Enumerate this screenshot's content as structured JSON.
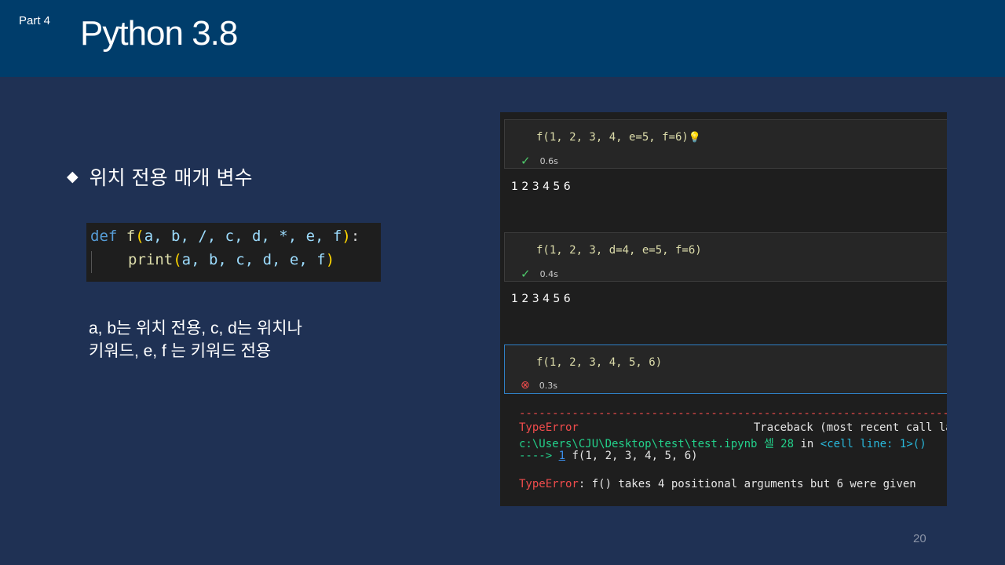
{
  "header": {
    "part": "Part 4",
    "title": "Python 3.8"
  },
  "bullet": {
    "symbol": "◆",
    "text": "위치 전용 매개 변수"
  },
  "code_snippet": {
    "line1": {
      "def": "def",
      "space": " ",
      "fname": "f",
      "open": "(",
      "params": "a, b, /, c, d, *, e, f",
      "close": ")",
      "colon": ":"
    },
    "line2": {
      "fname": "print",
      "open": "(",
      "args": "a, b, c, d, e, f",
      "close": ")"
    }
  },
  "description": {
    "line1": "a, b는 위치 전용, c, d는 위치나",
    "line2": "키워드, e, f 는 키워드 전용"
  },
  "notebook": {
    "cells": [
      {
        "code": "f(1, 2, 3, 4, e=5, f=6)",
        "time": "0.6s",
        "status": "success",
        "output": "1 2 3 4 5 6"
      },
      {
        "code": "f(1, 2, 3, d=4, e=5, f=6)",
        "time": "0.4s",
        "status": "success",
        "output": "1 2 3 4 5 6"
      },
      {
        "code": "f(1, 2, 3, 4, 5, 6)",
        "time": "0.3s",
        "status": "error"
      }
    ],
    "traceback": {
      "dashes": "---------------------------------------------------------------------------",
      "error_type": "TypeError",
      "header_right": "Traceback (most recent call last)",
      "path_line": "c:\\Users\\CJU\\Desktop\\test\\test.ipynb 셀 28",
      "in_word": "in",
      "cell_ref": "<cell line: 1>()",
      "arrow": "---->",
      "line_no": "1",
      "call": "f(1, 2, 3, 4, 5, 6)",
      "final_type": "TypeError",
      "final_msg": ": f() takes 4 positional arguments but 6 were given"
    }
  },
  "page_number": "20"
}
